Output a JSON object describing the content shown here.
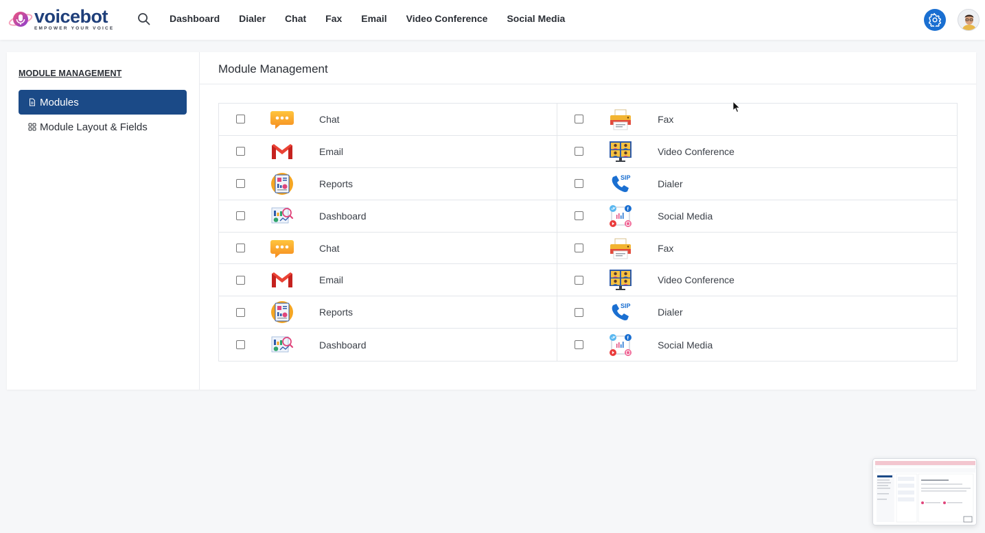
{
  "brand": {
    "name": "voicebot",
    "tagline": "EMPOWER YOUR VOICE",
    "primary_color": "#1f3f7a",
    "accent_color": "#e0457b"
  },
  "topnav": {
    "search_icon": "search-icon",
    "items": [
      "Dashboard",
      "Dialer",
      "Chat",
      "Fax",
      "Email",
      "Video Conference",
      "Social Media"
    ],
    "settings_icon": "gear-icon",
    "settings_color": "#1a6fd1",
    "avatar": "user-avatar"
  },
  "sidebar": {
    "title": "MODULE MANAGEMENT",
    "items": [
      {
        "label": "Modules",
        "icon": "document-icon",
        "active": true,
        "active_color": "#1b4a87"
      },
      {
        "label": "Module Layout & Fields",
        "icon": "layout-grid-icon",
        "active": false
      }
    ]
  },
  "main": {
    "title": "Module Management",
    "rows": [
      {
        "left": {
          "label": "Chat",
          "icon": "chat-bubble-icon",
          "checked": false
        },
        "right": {
          "label": "Fax",
          "icon": "printer-icon",
          "checked": false
        }
      },
      {
        "left": {
          "label": "Email",
          "icon": "gmail-icon",
          "checked": false
        },
        "right": {
          "label": "Video Conference",
          "icon": "video-conference-icon",
          "checked": false
        }
      },
      {
        "left": {
          "label": "Reports",
          "icon": "reports-icon",
          "checked": false
        },
        "right": {
          "label": "Dialer",
          "icon": "sip-phone-icon",
          "checked": false
        }
      },
      {
        "left": {
          "label": "Dashboard",
          "icon": "dashboard-icon",
          "checked": false
        },
        "right": {
          "label": "Social Media",
          "icon": "social-media-icon",
          "checked": false
        }
      },
      {
        "left": {
          "label": "Chat",
          "icon": "chat-bubble-icon",
          "checked": false
        },
        "right": {
          "label": "Fax",
          "icon": "printer-icon",
          "checked": false
        }
      },
      {
        "left": {
          "label": "Email",
          "icon": "gmail-icon",
          "checked": false
        },
        "right": {
          "label": "Video Conference",
          "icon": "video-conference-icon",
          "checked": false
        }
      },
      {
        "left": {
          "label": "Reports",
          "icon": "reports-icon",
          "checked": false
        },
        "right": {
          "label": "Dialer",
          "icon": "sip-phone-icon",
          "checked": false
        }
      },
      {
        "left": {
          "label": "Dashboard",
          "icon": "dashboard-icon",
          "checked": false
        },
        "right": {
          "label": "Social Media",
          "icon": "social-media-icon",
          "checked": false
        }
      }
    ]
  }
}
